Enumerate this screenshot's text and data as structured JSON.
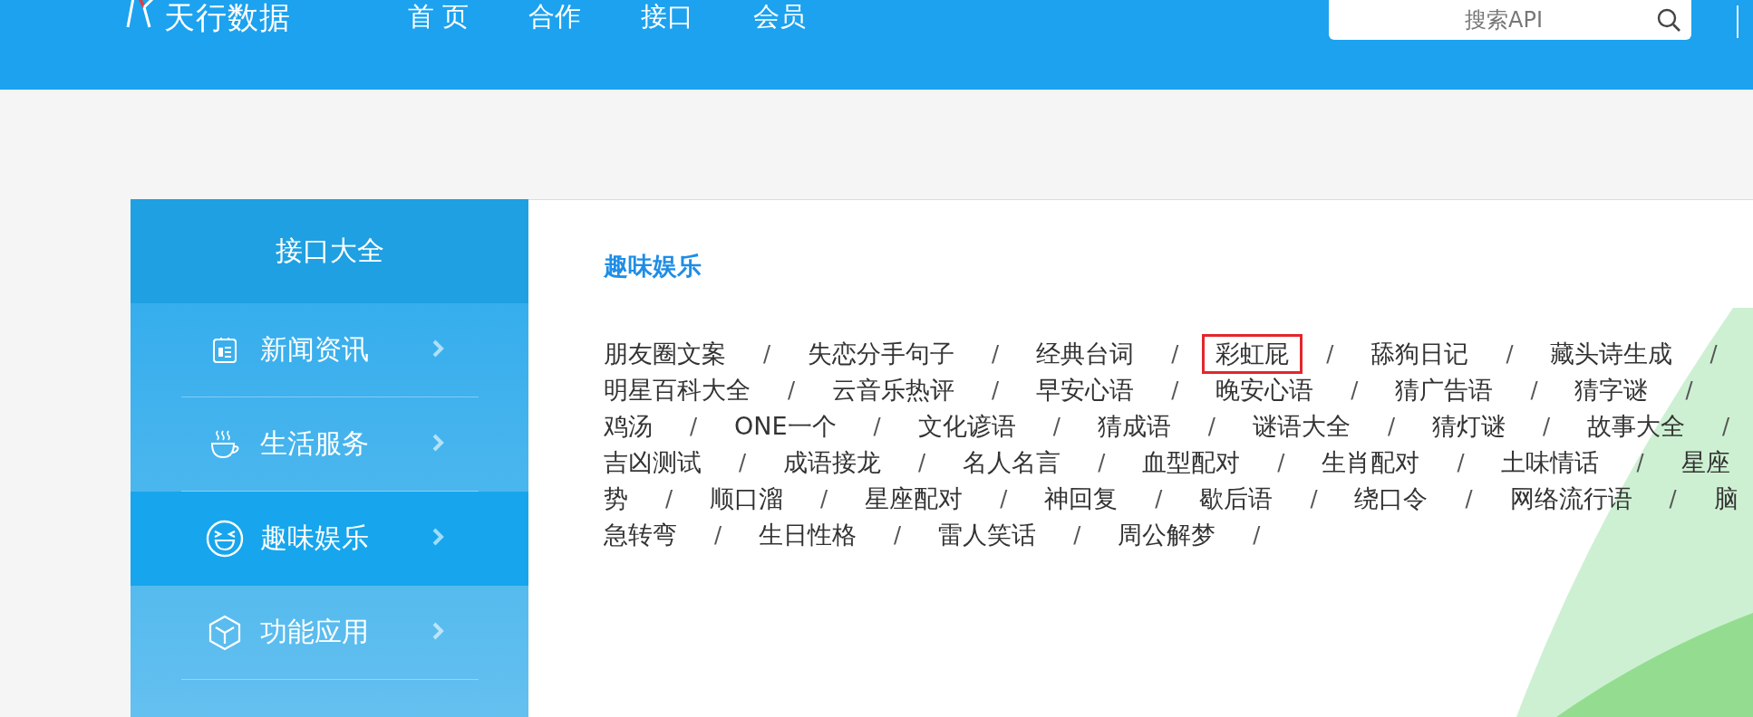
{
  "header": {
    "logo": "天行数据",
    "nav": [
      "首 页",
      "合作",
      "接口",
      "会员"
    ],
    "search": {
      "placeholder": "搜索API"
    }
  },
  "sidebar": {
    "title": "接口大全",
    "items": [
      {
        "label": "新闻资讯",
        "selected": false
      },
      {
        "label": "生活服务",
        "selected": false
      },
      {
        "label": "趣味娱乐",
        "selected": true
      },
      {
        "label": "功能应用",
        "selected": false
      }
    ]
  },
  "content": {
    "title": "趣味娱乐",
    "lines": [
      [
        {
          "kind": "item",
          "text": "朋友圈文案",
          "highlighted": false
        },
        {
          "kind": "sep",
          "text": "/"
        },
        {
          "kind": "item",
          "text": "失恋分手句子",
          "highlighted": false
        },
        {
          "kind": "sep",
          "text": "/"
        },
        {
          "kind": "item",
          "text": "经典台词",
          "highlighted": false
        },
        {
          "kind": "sep",
          "text": "/"
        },
        {
          "kind": "item",
          "text": "彩虹屁",
          "highlighted": true
        },
        {
          "kind": "sep",
          "text": "/"
        },
        {
          "kind": "item",
          "text": "舔狗日记",
          "highlighted": false
        },
        {
          "kind": "sep",
          "text": "/"
        },
        {
          "kind": "item",
          "text": "藏头诗生成",
          "highlighted": false
        },
        {
          "kind": "sep",
          "text": "/"
        }
      ],
      [
        {
          "kind": "item",
          "text": "明星百科大全",
          "highlighted": false
        },
        {
          "kind": "sep",
          "text": "/"
        },
        {
          "kind": "item",
          "text": "云音乐热评",
          "highlighted": false
        },
        {
          "kind": "sep",
          "text": "/"
        },
        {
          "kind": "item",
          "text": "早安心语",
          "highlighted": false
        },
        {
          "kind": "sep",
          "text": "/"
        },
        {
          "kind": "item",
          "text": "晚安心语",
          "highlighted": false
        },
        {
          "kind": "sep",
          "text": "/"
        },
        {
          "kind": "item",
          "text": "猜广告语",
          "highlighted": false
        },
        {
          "kind": "sep",
          "text": "/"
        },
        {
          "kind": "item",
          "text": "猜字谜",
          "highlighted": false
        },
        {
          "kind": "sep",
          "text": "/"
        }
      ],
      [
        {
          "kind": "item",
          "text": "鸡汤",
          "highlighted": false
        },
        {
          "kind": "sep",
          "text": "/"
        },
        {
          "kind": "item",
          "text": "ONE一个",
          "highlighted": false
        },
        {
          "kind": "sep",
          "text": "/"
        },
        {
          "kind": "item",
          "text": "文化谚语",
          "highlighted": false
        },
        {
          "kind": "sep",
          "text": "/"
        },
        {
          "kind": "item",
          "text": "猜成语",
          "highlighted": false
        },
        {
          "kind": "sep",
          "text": "/"
        },
        {
          "kind": "item",
          "text": "谜语大全",
          "highlighted": false
        },
        {
          "kind": "sep",
          "text": "/"
        },
        {
          "kind": "item",
          "text": "猜灯谜",
          "highlighted": false
        },
        {
          "kind": "sep",
          "text": "/"
        },
        {
          "kind": "item",
          "text": "故事大全",
          "highlighted": false
        },
        {
          "kind": "sep",
          "text": "/"
        }
      ],
      [
        {
          "kind": "item",
          "text": "吉凶测试",
          "highlighted": false
        },
        {
          "kind": "sep",
          "text": "/"
        },
        {
          "kind": "item",
          "text": "成语接龙",
          "highlighted": false
        },
        {
          "kind": "sep",
          "text": "/"
        },
        {
          "kind": "item",
          "text": "名人名言",
          "highlighted": false
        },
        {
          "kind": "sep",
          "text": "/"
        },
        {
          "kind": "item",
          "text": "血型配对",
          "highlighted": false
        },
        {
          "kind": "sep",
          "text": "/"
        },
        {
          "kind": "item",
          "text": "生肖配对",
          "highlighted": false
        },
        {
          "kind": "sep",
          "text": "/"
        },
        {
          "kind": "item",
          "text": "土味情话",
          "highlighted": false
        },
        {
          "kind": "sep",
          "text": "/"
        },
        {
          "kind": "item",
          "text": "星座",
          "highlighted": false
        }
      ],
      [
        {
          "kind": "item",
          "text": "势",
          "highlighted": false
        },
        {
          "kind": "sep",
          "text": "/"
        },
        {
          "kind": "item",
          "text": "顺口溜",
          "highlighted": false
        },
        {
          "kind": "sep",
          "text": "/"
        },
        {
          "kind": "item",
          "text": "星座配对",
          "highlighted": false
        },
        {
          "kind": "sep",
          "text": "/"
        },
        {
          "kind": "item",
          "text": "神回复",
          "highlighted": false
        },
        {
          "kind": "sep",
          "text": "/"
        },
        {
          "kind": "item",
          "text": "歇后语",
          "highlighted": false
        },
        {
          "kind": "sep",
          "text": "/"
        },
        {
          "kind": "item",
          "text": "绕口令",
          "highlighted": false
        },
        {
          "kind": "sep",
          "text": "/"
        },
        {
          "kind": "item",
          "text": "网络流行语",
          "highlighted": false
        },
        {
          "kind": "sep",
          "text": "/"
        },
        {
          "kind": "item",
          "text": "脑",
          "highlighted": false
        }
      ],
      [
        {
          "kind": "item",
          "text": "急转弯",
          "highlighted": false
        },
        {
          "kind": "sep",
          "text": "/"
        },
        {
          "kind": "item",
          "text": "生日性格",
          "highlighted": false
        },
        {
          "kind": "sep",
          "text": "/"
        },
        {
          "kind": "item",
          "text": "雷人笑话",
          "highlighted": false
        },
        {
          "kind": "sep",
          "text": "/"
        },
        {
          "kind": "item",
          "text": "周公解梦",
          "highlighted": false
        },
        {
          "kind": "sep",
          "text": "/"
        }
      ]
    ]
  }
}
